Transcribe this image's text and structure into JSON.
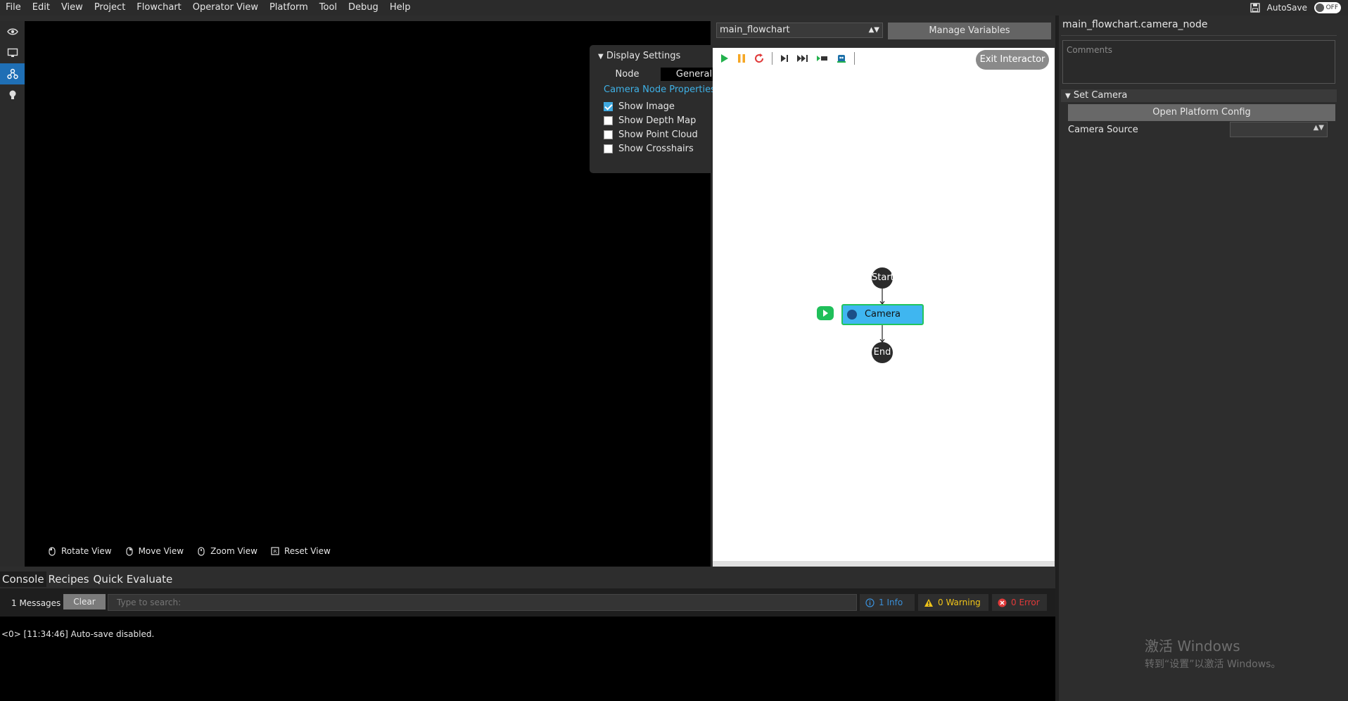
{
  "menu": [
    "File",
    "Edit",
    "View",
    "Project",
    "Flowchart",
    "Operator View",
    "Platform",
    "Tool",
    "Debug",
    "Help"
  ],
  "topright": {
    "autosave_label": "AutoSave",
    "toggle_text": "OFF"
  },
  "display_settings": {
    "title": "Display Settings",
    "tabs": [
      "Node",
      "General"
    ],
    "active_tab": "General",
    "link": "Camera Node Properties",
    "options": [
      {
        "label": "Show Image",
        "checked": true
      },
      {
        "label": "Show Depth Map",
        "checked": false
      },
      {
        "label": "Show Point Cloud",
        "checked": false
      },
      {
        "label": "Show Crosshairs",
        "checked": false
      }
    ]
  },
  "view_hints": [
    "Rotate View",
    "Move View",
    "Zoom View",
    "Reset View"
  ],
  "flowchart": {
    "selected": "main_flowchart",
    "manage_vars": "Manage Variables",
    "exit_interactor": "Exit Interactor",
    "nodes": {
      "start": "Start",
      "camera": "Camera",
      "end": "End"
    }
  },
  "props": {
    "title": "main_flowchart.camera_node",
    "comments_placeholder": "Comments",
    "section": "Set Camera",
    "open_platform": "Open Platform Config",
    "camera_source_label": "Camera Source"
  },
  "console": {
    "tabs": [
      "Console",
      "Recipes",
      "Quick Evaluate"
    ],
    "messages": "1 Messages",
    "clear": "Clear",
    "search_placeholder": "Type to search:",
    "info": "1 Info",
    "warning": "0 Warning",
    "error": "0 Error",
    "line": "<0> [11:34:46] Auto-save disabled."
  },
  "watermark": {
    "line1": "激活 Windows",
    "line2": "转到“设置”以激活 Windows。"
  },
  "colors": {
    "accent": "#3fb1e6",
    "node": "#3fb6f0",
    "active_border": "#22c55e",
    "warning": "#f0c419",
    "error": "#e03a3a"
  }
}
